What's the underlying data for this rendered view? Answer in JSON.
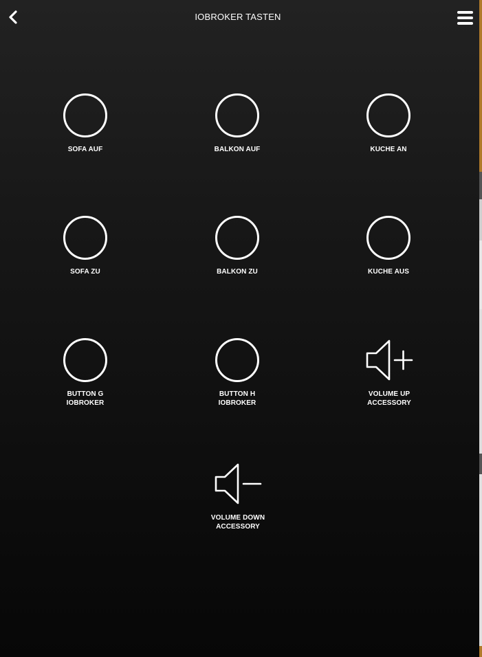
{
  "header": {
    "title": "IOBROKER TASTEN",
    "back_icon": "chevron-left-icon",
    "menu_icon": "hamburger-menu-icon"
  },
  "accessories": [
    {
      "label": "SOFA AUF",
      "icon": "circle-button-icon"
    },
    {
      "label": "BALKON AUF",
      "icon": "circle-button-icon"
    },
    {
      "label": "KUCHE AN",
      "icon": "circle-button-icon"
    },
    {
      "label": "SOFA ZU",
      "icon": "circle-button-icon"
    },
    {
      "label": "BALKON ZU",
      "icon": "circle-button-icon"
    },
    {
      "label": "KUCHE AUS",
      "icon": "circle-button-icon"
    },
    {
      "label": "BUTTON G\nIOBROKER",
      "icon": "circle-button-icon"
    },
    {
      "label": "BUTTON H\nIOBROKER",
      "icon": "circle-button-icon"
    },
    {
      "label": "VOLUME UP\nACCESSORY",
      "icon": "speaker-volume-up-icon"
    },
    {
      "label": "VOLUME DOWN\nACCESSORY",
      "icon": "speaker-volume-down-icon"
    }
  ],
  "colors": {
    "foreground": "#ffffff",
    "background_top": "#222222",
    "background_bottom": "#070707"
  }
}
